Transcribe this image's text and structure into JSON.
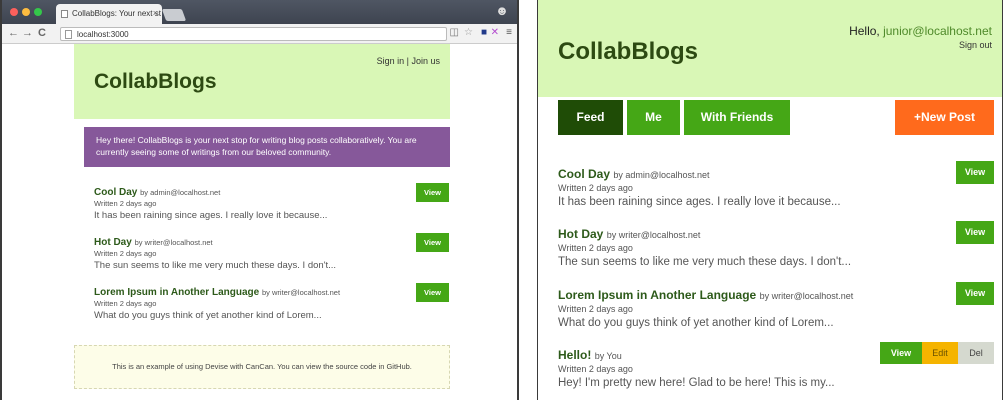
{
  "browser": {
    "tab_title": "CollabBlogs: Your next st",
    "url": "localhost:3000"
  },
  "left": {
    "brand": "CollabBlogs",
    "auth": "Sign in | Join us",
    "intro": "Hey there! CollabBlogs is your next stop for writing blog posts collaboratively. You are currently seeing some of writings from our beloved community.",
    "view_label": "View",
    "posts": [
      {
        "title": "Cool Day",
        "by": "by admin@localhost.net",
        "meta": "Written 2 days ago",
        "excerpt": "It has been raining since ages. I really love it because..."
      },
      {
        "title": "Hot Day",
        "by": "by writer@localhost.net",
        "meta": "Written 2 days ago",
        "excerpt": "The sun seems to like me very much these days. I don't..."
      },
      {
        "title": "Lorem Ipsum in Another Language",
        "by": "by writer@localhost.net",
        "meta": "Written 2 days ago",
        "excerpt": "What do you guys think of yet another kind of Lorem..."
      }
    ],
    "footer": "This is an example of using Devise with CanCan. You can view the source code in GitHub."
  },
  "right": {
    "brand": "CollabBlogs",
    "hello_prefix": "Hello, ",
    "hello_user": "junior@localhost.net",
    "signout": "Sign out",
    "nav": {
      "feed": "Feed",
      "me": "Me",
      "friends": "With Friends",
      "new_post": "+New Post"
    },
    "view_label": "View",
    "edit_label": "Edit",
    "del_label": "Del",
    "posts": [
      {
        "title": "Cool Day",
        "by": "by admin@localhost.net",
        "meta": "Written 2 days ago",
        "excerpt": "It has been raining since ages. I really love it because..."
      },
      {
        "title": "Hot Day",
        "by": "by writer@localhost.net",
        "meta": "Written 2 days ago",
        "excerpt": "The sun seems to like me very much these days. I don't..."
      },
      {
        "title": "Lorem Ipsum in Another Language",
        "by": "by writer@localhost.net",
        "meta": "Written 2 days ago",
        "excerpt": "What do you guys think of yet another kind of Lorem..."
      },
      {
        "title": "Hello!",
        "by": "by You",
        "meta": "Written 2 days ago",
        "excerpt": "Hey! I'm pretty new here! Glad to be here! This is my..."
      }
    ]
  },
  "colors": {
    "header_bg": "#d9f7b6",
    "brand_green": "#2d4a12",
    "button_green": "#45a716",
    "nav_active": "#1f4c06",
    "new_post_orange": "#ff6a1c",
    "intro_purple": "#86589a",
    "edit_yellow": "#f5b400"
  }
}
